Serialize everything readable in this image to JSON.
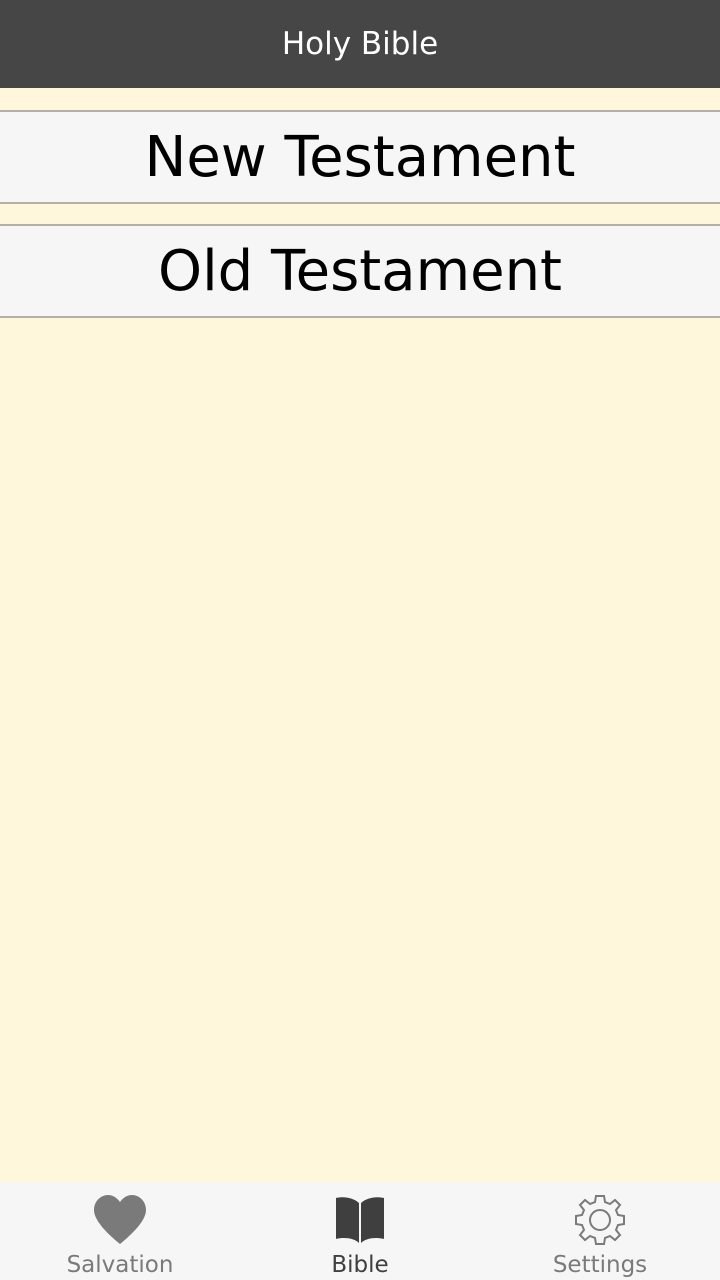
{
  "header": {
    "title": "Holy Bible"
  },
  "main": {
    "buttons": [
      {
        "label": "New Testament"
      },
      {
        "label": "Old Testament"
      }
    ]
  },
  "tabs": [
    {
      "label": "Salvation",
      "icon": "heart-icon",
      "active": false
    },
    {
      "label": "Bible",
      "icon": "book-icon",
      "active": true
    },
    {
      "label": "Settings",
      "icon": "gear-icon",
      "active": false
    }
  ],
  "colors": {
    "header_bg": "#464646",
    "content_bg": "#fff7dc",
    "button_bg": "#f6f6f6",
    "tab_bar_bg": "#f6f6f6",
    "active_tab": "#3f3f3f",
    "inactive_tab": "#7a7a7a"
  }
}
